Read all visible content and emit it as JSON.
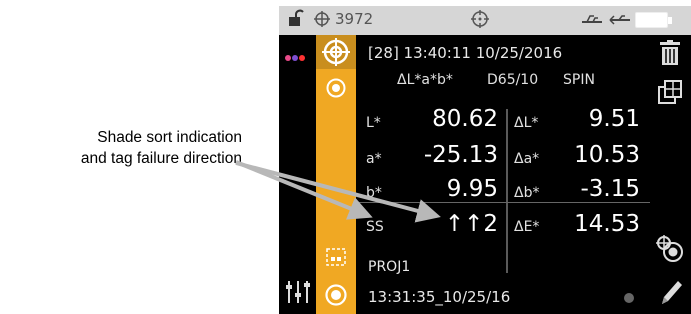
{
  "callout": {
    "line1": "Shade sort indication",
    "line2": "and tag failure direction"
  },
  "status_bar": {
    "count": "3972",
    "icons": [
      "unlocked-padlock-icon",
      "crosshair-icon",
      "target-icon",
      "usb-icon",
      "usb-icon",
      "battery-icon"
    ]
  },
  "screen": {
    "header": "[28] 13:40:11 10/25/2016",
    "mode": "ΔL*a*b*",
    "illuminant": "D65/10",
    "spec_mode": "SPIN",
    "rows": [
      {
        "label": "L*",
        "value": "80.62",
        "delta_label": "ΔL*",
        "delta_value": "9.51"
      },
      {
        "label": "a*",
        "value": "-25.13",
        "delta_label": "Δa*",
        "delta_value": "10.53"
      },
      {
        "label": "b*",
        "value": "9.95",
        "delta_label": "Δb*",
        "delta_value": "-3.15"
      },
      {
        "label": "SS",
        "value": "↑↑2",
        "delta_label": "ΔE*",
        "delta_value": "14.53"
      }
    ],
    "project": "PROJ1",
    "timestamp": "13:31:35_10/25/16"
  },
  "colors": {
    "accent": "#f0a823",
    "background": "#000000",
    "status_bar": "#d6d6d6",
    "dots": [
      "#e94b8a",
      "#7d4fd0",
      "#ff3333"
    ]
  }
}
